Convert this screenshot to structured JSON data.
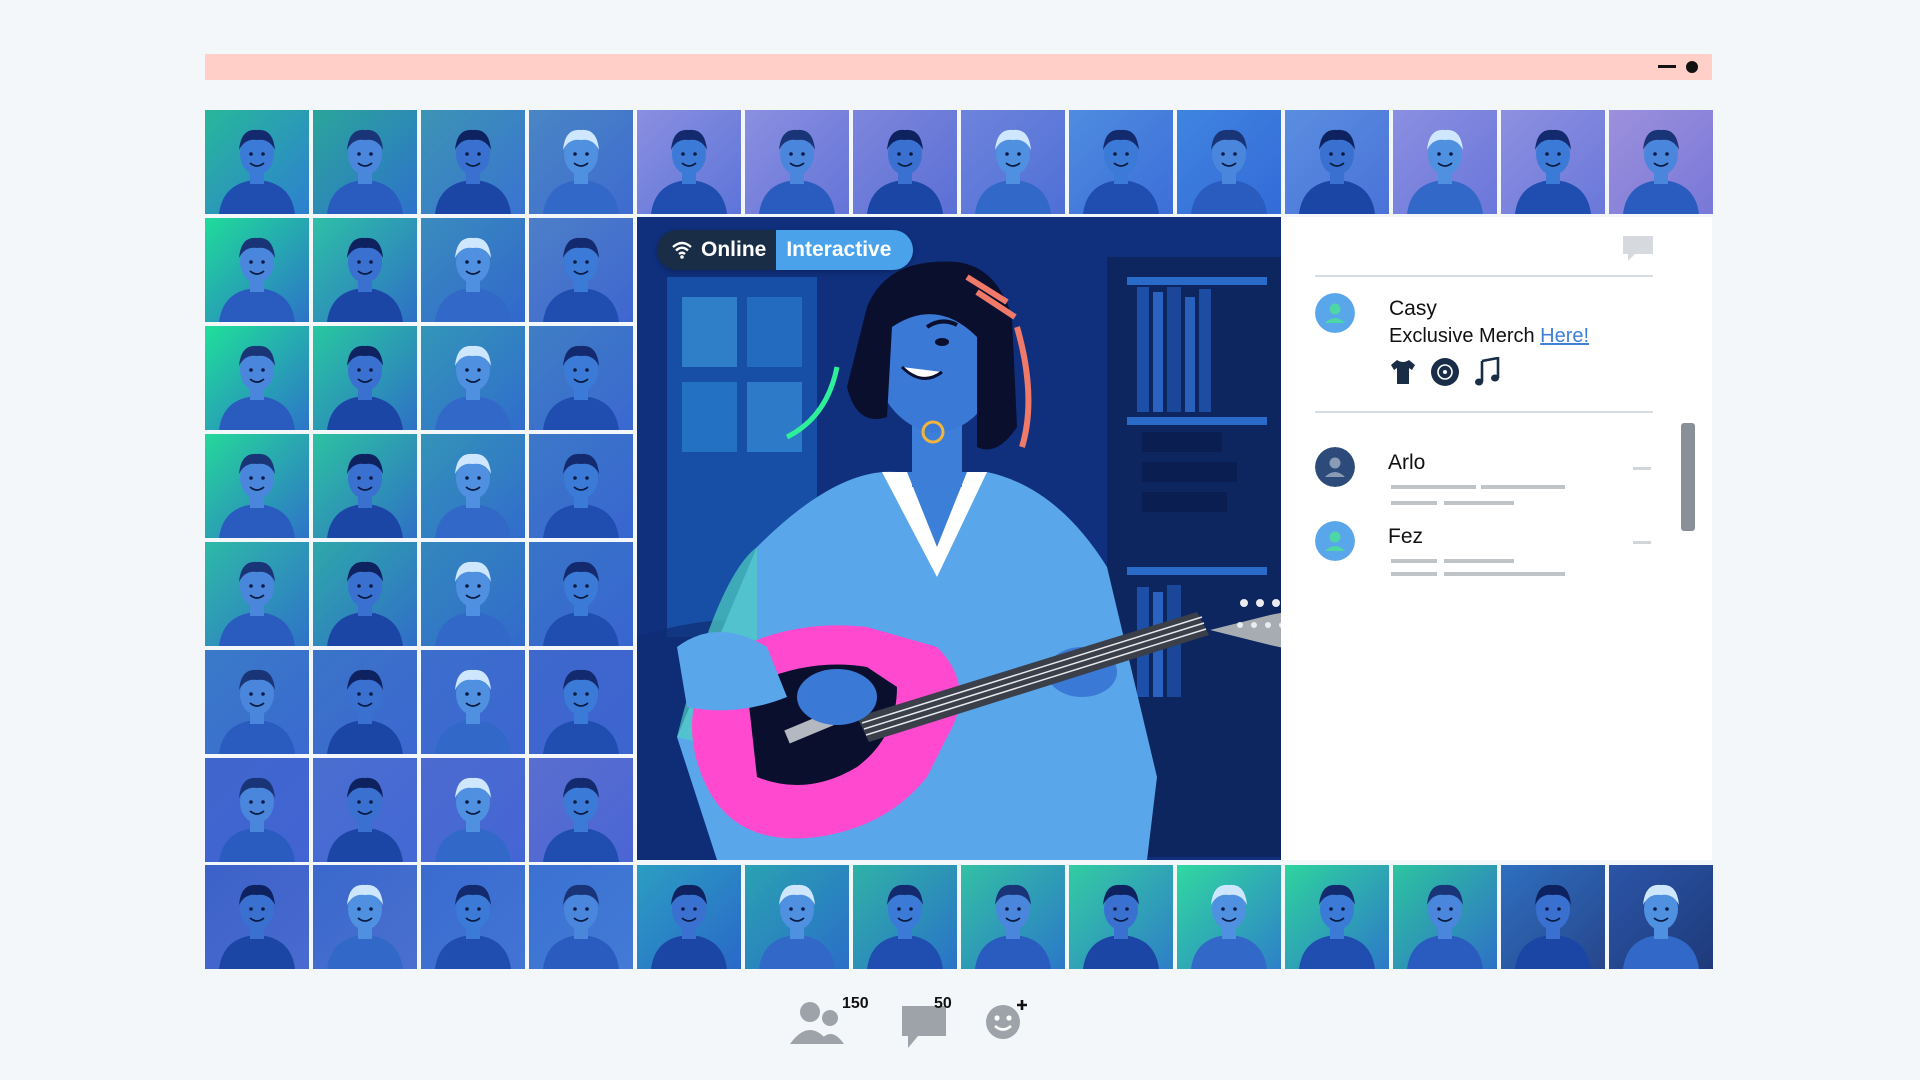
{
  "window": {
    "controls": [
      "minimize-icon",
      "close-icon"
    ],
    "titlebar_color": "#ffcfc8"
  },
  "participants": {
    "top_row_tiles": 14,
    "left_grid_tiles": 24,
    "bottom_row_tiles": 14
  },
  "stage": {
    "status_online": "Online",
    "status_mode": "Interactive",
    "status_icon": "wifi-icon"
  },
  "chat": {
    "toggle_icon": "chat-bubble-icon",
    "pinned": {
      "name": "Casy",
      "message": "Exclusive Merch",
      "link": "Here!",
      "merch_icons": [
        "tshirt-icon",
        "vinyl-record-icon",
        "music-note-icon"
      ]
    },
    "messages": [
      {
        "name": "Arlo"
      },
      {
        "name": "Fez"
      }
    ]
  },
  "footer": {
    "participants_count": "150",
    "messages_count": "50",
    "reactions_icon": "add-reaction-icon"
  },
  "colors": {
    "accent_blue": "#4aa3ea",
    "link": "#3f7fd6",
    "dark_navy": "#1a2d46"
  }
}
